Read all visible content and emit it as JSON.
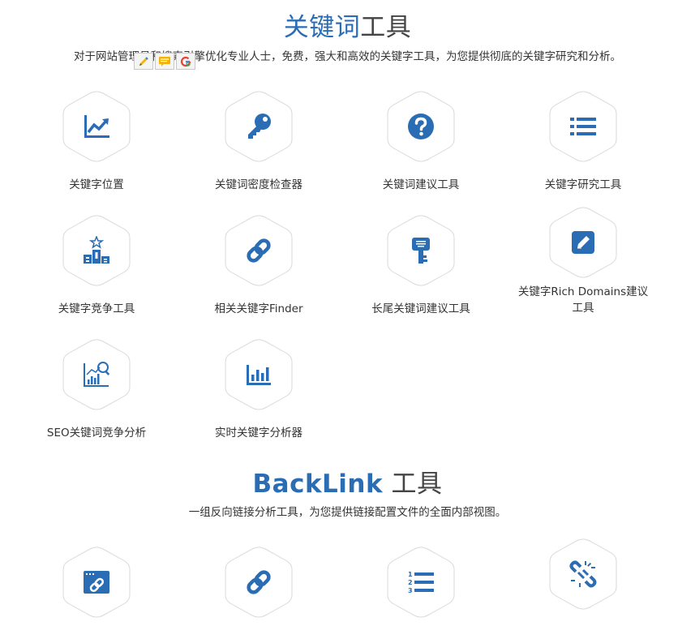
{
  "keyword_section": {
    "title_accent": "关键词",
    "title_rest": "工具",
    "subtitle": "对于网站管理员和搜索引擎优化专业人士，免费，强大和高效的关键字工具，为您提供彻底的关键字研究和分析。",
    "tools": [
      {
        "label": "关键字位置",
        "icon": "chart-line-icon"
      },
      {
        "label": "关键词密度检查器",
        "icon": "key-icon"
      },
      {
        "label": "关键词建议工具",
        "icon": "question-circle-icon"
      },
      {
        "label": "关键字研究工具",
        "icon": "list-icon"
      },
      {
        "label": "关键字竞争工具",
        "icon": "podium-icon"
      },
      {
        "label": "相关关键字Finder",
        "icon": "link-icon"
      },
      {
        "label": "长尾关键词建议工具",
        "icon": "key-tag-icon"
      },
      {
        "label": "关键字Rich Domains建议工具",
        "icon": "edit-icon"
      },
      {
        "label": "SEO关键词竞争分析",
        "icon": "chart-search-icon"
      },
      {
        "label": "实时关键字分析器",
        "icon": "bar-chart-icon"
      }
    ]
  },
  "backlink_section": {
    "title_accent": "BackLink",
    "title_rest": " 工具",
    "subtitle": "一组反向链接分析工具，为您提供链接配置文件的全面内部视图。",
    "tools": [
      {
        "icon": "browser-link-icon"
      },
      {
        "icon": "link-icon"
      },
      {
        "icon": "numbered-list-icon"
      },
      {
        "icon": "broken-link-icon"
      }
    ]
  },
  "colors": {
    "accent": "#2a6db5",
    "hex_border": "#d9d9d9",
    "text": "#333333"
  }
}
